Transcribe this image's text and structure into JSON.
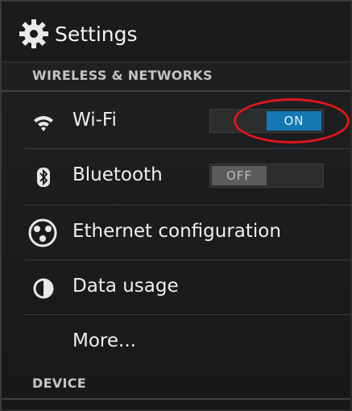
{
  "app": {
    "title": "Settings",
    "icon": "gear-icon"
  },
  "sections": {
    "wireless": "WIRELESS & NETWORKS",
    "device": "DEVICE"
  },
  "items": {
    "wifi": {
      "label": "Wi-Fi",
      "icon": "wifi-icon",
      "toggle": "ON",
      "state": "on"
    },
    "bluetooth": {
      "label": "Bluetooth",
      "icon": "bluetooth-icon",
      "toggle": "OFF",
      "state": "off"
    },
    "ethernet": {
      "label": "Ethernet configuration",
      "icon": "ethernet-icon"
    },
    "data_usage": {
      "label": "Data usage",
      "icon": "data-usage-icon"
    },
    "more": {
      "label": "More..."
    }
  },
  "annotation": {
    "color": "#e3141c",
    "target": "wifi-toggle"
  },
  "colors": {
    "toggle_on": "#1479b2",
    "toggle_off": "#5a5c5e",
    "background": "#1b1d1f"
  }
}
